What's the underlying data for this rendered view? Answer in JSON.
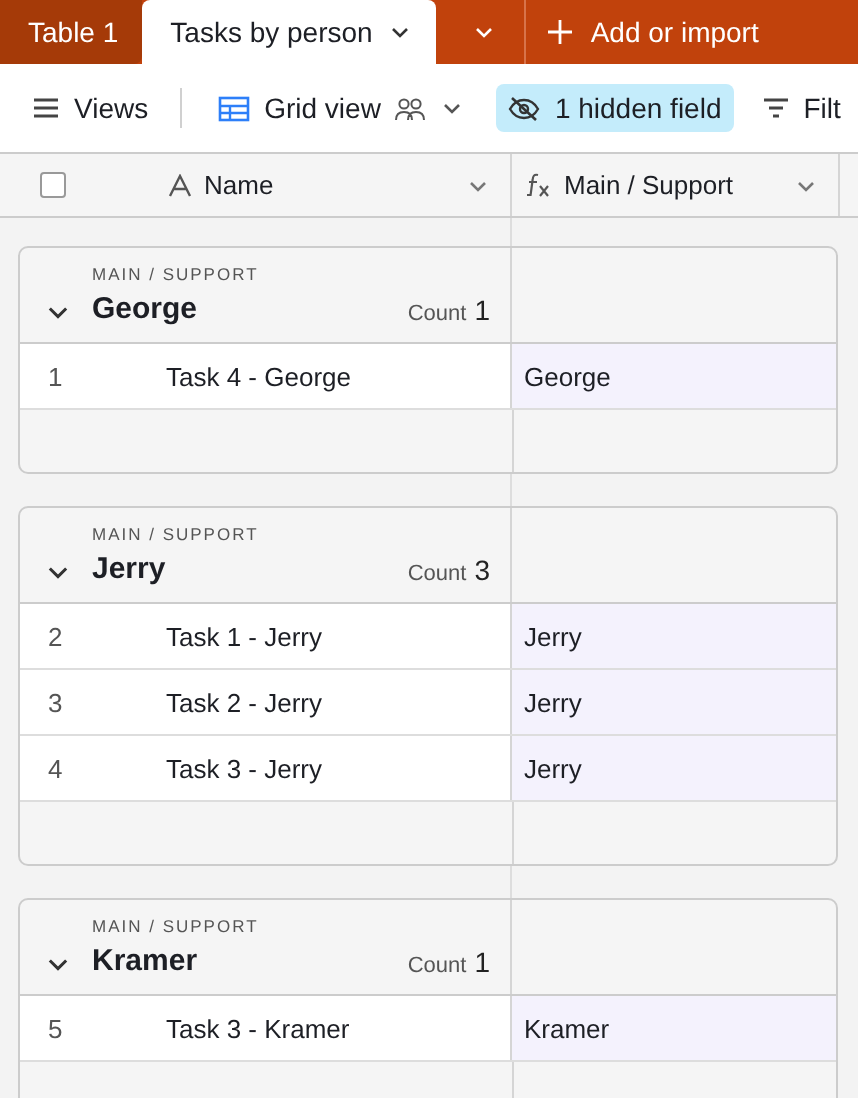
{
  "tabs": [
    {
      "label": "Table 1",
      "selected": false
    },
    {
      "label": "Tasks by person",
      "selected": true
    }
  ],
  "add_button": {
    "label": "Add or import"
  },
  "toolbar": {
    "views": "Views",
    "grid_view": "Grid view",
    "hidden_fields": "1 hidden field",
    "filter": "Filt"
  },
  "select_all": {
    "checked": false
  },
  "columns": [
    {
      "label": "Name",
      "kind": "text"
    },
    {
      "label": "Main / Support",
      "kind": "formula"
    }
  ],
  "groups": [
    {
      "field": "MAIN / SUPPORT",
      "value": "George",
      "count_label": "Count",
      "count": "1",
      "rows": [
        {
          "number": "1",
          "name": "Task 4 - George",
          "main_support": "George"
        }
      ]
    },
    {
      "field": "MAIN / SUPPORT",
      "value": "Jerry",
      "count_label": "Count",
      "count": "3",
      "rows": [
        {
          "number": "2",
          "name": "Task 1 - Jerry",
          "main_support": "Jerry"
        },
        {
          "number": "3",
          "name": "Task 2 - Jerry",
          "main_support": "Jerry"
        },
        {
          "number": "4",
          "name": "Task 3 - Jerry",
          "main_support": "Jerry"
        }
      ]
    },
    {
      "field": "MAIN / SUPPORT",
      "value": "Kramer",
      "count_label": "Count",
      "count": "1",
      "rows": [
        {
          "number": "5",
          "name": "Task 3 - Kramer",
          "main_support": "Kramer"
        }
      ]
    }
  ]
}
